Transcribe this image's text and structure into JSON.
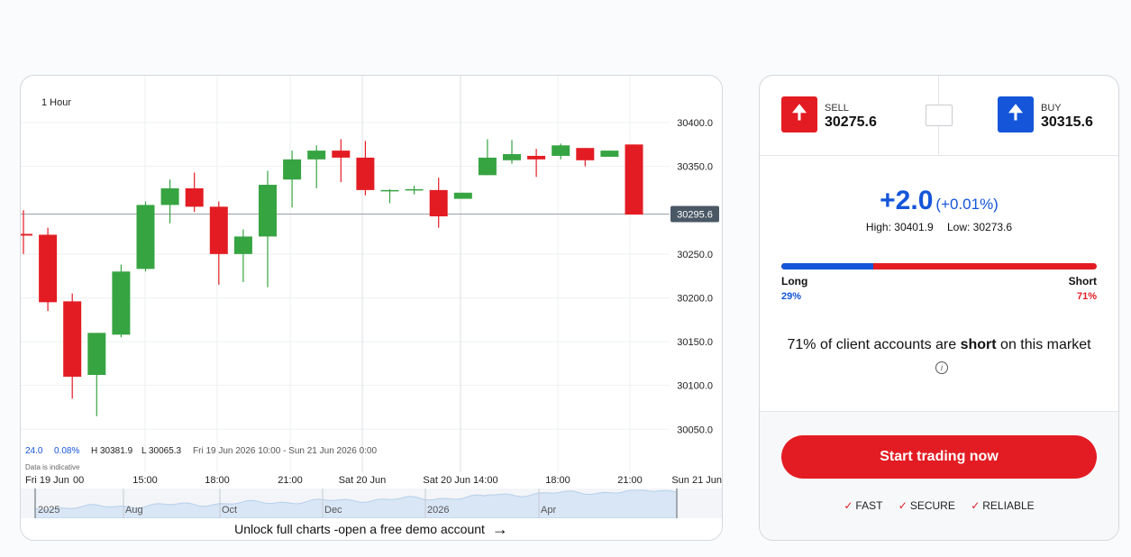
{
  "chart_data": {
    "type": "candlestick",
    "interval_label": "1 Hour",
    "ylim": [
      30010,
      30440
    ],
    "y_ticks": [
      30400.0,
      30350.0,
      30250.0,
      30200.0,
      30150.0,
      30100.0,
      30050.0
    ],
    "y_tick_labels": [
      "30400.0",
      "30350.0",
      "30250.0",
      "30200.0",
      "30150.0",
      "30100.0",
      "30050.0"
    ],
    "current_price": 30295.6,
    "current_price_label": "30295.6",
    "x_tick_labels": [
      "Fri 19 Jun",
      "00",
      "15:00",
      "18:00",
      "21:00",
      "Sat 20 Jun",
      "Sat 20 Jun 14:00",
      "18:00",
      "21:00",
      "Sun 21 Jun"
    ],
    "info": {
      "last": "24.0",
      "change_pct": "0.08%",
      "high": "H 30381.9",
      "low": "L 30065.3",
      "range": "Fri 19 Jun 2026 10:00 - Sun 21 Jun 2026 0:00",
      "note": "Data is indicative"
    },
    "colors": {
      "up": "#37a442",
      "down": "#e31c23"
    },
    "candles": [
      {
        "o": 30273,
        "h": 30300,
        "l": 30250,
        "c": 30271
      },
      {
        "o": 30272,
        "h": 30280,
        "l": 30185,
        "c": 30195
      },
      {
        "o": 30196,
        "h": 30205,
        "l": 30085,
        "c": 30110
      },
      {
        "o": 30112,
        "h": 30160,
        "l": 30065,
        "c": 30160
      },
      {
        "o": 30158,
        "h": 30238,
        "l": 30155,
        "c": 30230
      },
      {
        "o": 30233,
        "h": 30310,
        "l": 30230,
        "c": 30306
      },
      {
        "o": 30306,
        "h": 30335,
        "l": 30285,
        "c": 30325
      },
      {
        "o": 30325,
        "h": 30343,
        "l": 30298,
        "c": 30304
      },
      {
        "o": 30304,
        "h": 30310,
        "l": 30215,
        "c": 30250
      },
      {
        "o": 30250,
        "h": 30278,
        "l": 30218,
        "c": 30270
      },
      {
        "o": 30270,
        "h": 30345,
        "l": 30212,
        "c": 30329
      },
      {
        "o": 30335,
        "h": 30368,
        "l": 30303,
        "c": 30358
      },
      {
        "o": 30358,
        "h": 30374,
        "l": 30325,
        "c": 30368
      },
      {
        "o": 30368,
        "h": 30381,
        "l": 30332,
        "c": 30360
      },
      {
        "o": 30360,
        "h": 30379,
        "l": 30317,
        "c": 30323
      },
      {
        "o": 30322,
        "h": 30324,
        "l": 30308,
        "c": 30323
      },
      {
        "o": 30323,
        "h": 30328,
        "l": 30318,
        "c": 30324
      },
      {
        "o": 30323,
        "h": 30337,
        "l": 30280,
        "c": 30293
      },
      {
        "o": 30313,
        "h": 30320,
        "l": 30313,
        "c": 30320
      },
      {
        "o": 30340,
        "h": 30381,
        "l": 30340,
        "c": 30360
      },
      {
        "o": 30357,
        "h": 30380,
        "l": 30353,
        "c": 30364
      },
      {
        "o": 30362,
        "h": 30370,
        "l": 30338,
        "c": 30358
      },
      {
        "o": 30362,
        "h": 30376,
        "l": 30358,
        "c": 30374
      },
      {
        "o": 30371,
        "h": 30371,
        "l": 30350,
        "c": 30357
      },
      {
        "o": 30361,
        "h": 30368,
        "l": 30361,
        "c": 30368
      },
      {
        "o": 30375,
        "h": 30375,
        "l": 30295,
        "c": 30295
      }
    ],
    "navigator": {
      "labels": [
        "2025",
        "Aug",
        "Oct",
        "Dec",
        "2026",
        "Apr"
      ]
    }
  },
  "chart_footer": {
    "unlock_text": "Unlock full charts -open a free demo account",
    "arrow": "arrow-right-icon"
  },
  "trade": {
    "sell_label": "SELL",
    "sell_price": "30275.6",
    "buy_label": "BUY",
    "buy_price": "30315.6",
    "change": "+2.0",
    "change_pct": "(+0.01%)",
    "high": "High: 30401.9",
    "low": "Low: 30273.6",
    "long_label": "Long",
    "short_label": "Short",
    "long_pct": "29%",
    "short_pct": "71%",
    "long_value": 29,
    "sentiment_pct": "71% of client accounts are",
    "sentiment_word": "short",
    "sentiment_rest": "on this market",
    "cta": "Start trading now",
    "features": [
      "FAST",
      "SECURE",
      "RELIABLE"
    ],
    "colors": {
      "sell": "#e31c23",
      "buy": "#1455d9"
    }
  }
}
